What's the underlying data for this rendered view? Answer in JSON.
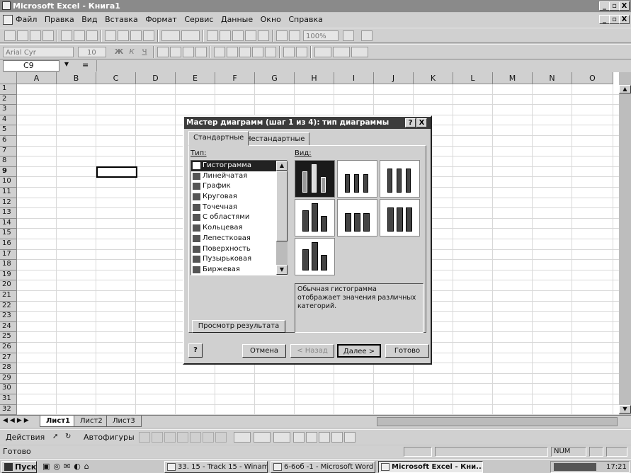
{
  "window": {
    "title": "Microsoft Excel - Книга1",
    "caption_buttons": [
      "_",
      "▫",
      "X"
    ]
  },
  "menu": [
    "Файл",
    "Правка",
    "Вид",
    "Вставка",
    "Формат",
    "Сервис",
    "Данные",
    "Окно",
    "Справка"
  ],
  "toolbar": {
    "zoom": "100%"
  },
  "format_toolbar": {
    "font": "Arial Cyr",
    "size": "10",
    "bold": "Ж",
    "italic": "К",
    "underline": "Ч"
  },
  "formula_bar": {
    "cell_ref": "C9",
    "equals": "="
  },
  "sheet": {
    "columns": [
      "A",
      "B",
      "C",
      "D",
      "E",
      "F",
      "G",
      "H",
      "I",
      "J",
      "K",
      "L",
      "M",
      "N",
      "O"
    ],
    "rows": [
      "1",
      "2",
      "3",
      "4",
      "5",
      "6",
      "7",
      "8",
      "9",
      "10",
      "11",
      "12",
      "13",
      "14",
      "15",
      "16",
      "17",
      "18",
      "19",
      "20",
      "21",
      "22",
      "23",
      "24",
      "25",
      "26",
      "27",
      "28",
      "29",
      "30",
      "31",
      "32"
    ],
    "active_cell": "C9",
    "tabs": [
      "Лист1",
      "Лист2",
      "Лист3"
    ]
  },
  "drawing_toolbar": {
    "actions": "Действия",
    "autoshapes": "Автофигуры"
  },
  "status": {
    "ready": "Готово",
    "num": "NUM"
  },
  "taskbar": {
    "start": "Пуск",
    "tasks": [
      "33. 15 - Track 15 - Winamp",
      "6-6об -1 - Microsoft Word",
      "Microsoft Excel - Кни..."
    ],
    "time": "17:21"
  },
  "dialog": {
    "title": "Мастер диаграмм (шаг 1 из 4): тип диаграммы",
    "help": "?",
    "close": "X",
    "tabs": [
      "Стандартные",
      "Нестандартные"
    ],
    "type_label": "Тип:",
    "view_label": "Вид:",
    "types": [
      "Гистограмма",
      "Линейчатая",
      "График",
      "Круговая",
      "Точечная",
      "С областями",
      "Кольцевая",
      "Лепестковая",
      "Поверхность",
      "Пузырьковая",
      "Биржевая"
    ],
    "selected_type": "Гистограмма",
    "description": "Обычная гистограмма отображает значения различных категорий.",
    "preview_button": "Просмотр результата",
    "buttons": {
      "cancel": "Отмена",
      "back": "< Назад",
      "next": "Далее >",
      "finish": "Готово"
    }
  }
}
